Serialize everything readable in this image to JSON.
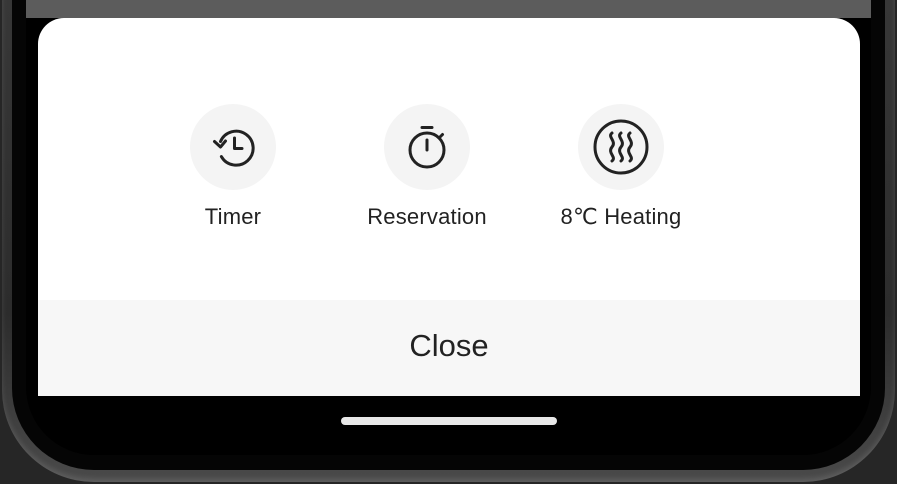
{
  "sheet": {
    "actions": [
      {
        "label": "Timer",
        "icon": "timer-history-icon"
      },
      {
        "label": "Reservation",
        "icon": "stopwatch-icon"
      },
      {
        "label": "8℃ Heating",
        "icon": "heating-waves-icon"
      }
    ],
    "close_label": "Close"
  },
  "colors": {
    "sheet_background": "#ffffff",
    "icon_circle": "#f4f4f4",
    "close_bar": "#f7f7f7",
    "text": "#222222"
  }
}
